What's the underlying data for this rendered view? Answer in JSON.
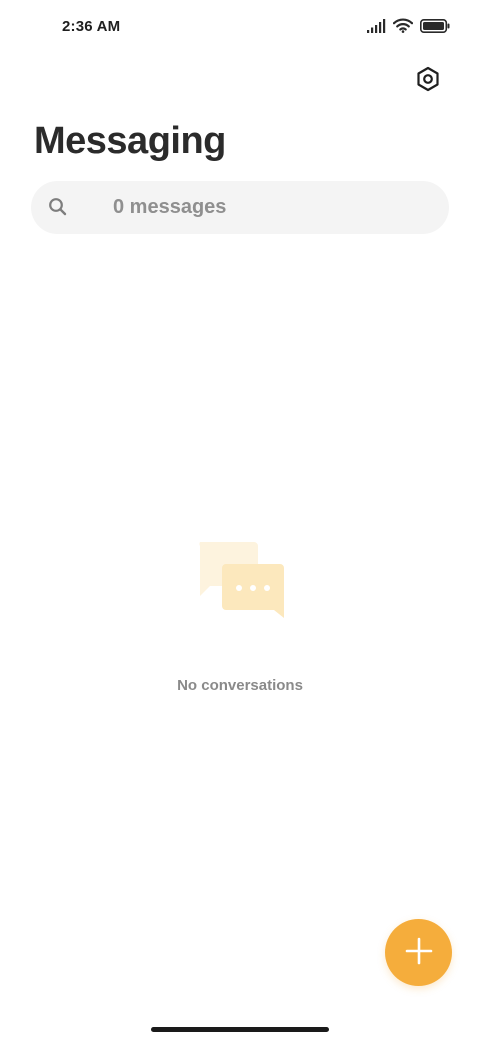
{
  "status_bar": {
    "time": "2:36 AM",
    "icons": [
      "signal-icon",
      "wifi-icon",
      "battery-icon"
    ]
  },
  "header": {
    "title": "Messaging",
    "settings_icon": "settings-gear-icon"
  },
  "search": {
    "placeholder": "0 messages",
    "value": "",
    "icon": "search-icon"
  },
  "empty_state": {
    "icon": "chat-bubbles-icon",
    "text": "No conversations"
  },
  "fab": {
    "icon": "plus-icon"
  },
  "colors": {
    "accent": "#f5ad3c",
    "title": "#2b2b2b",
    "muted_text": "#8a8a8a",
    "search_bg": "#f4f4f4",
    "illustration_back": "#fdf3de",
    "illustration_front": "#fce8bd"
  }
}
